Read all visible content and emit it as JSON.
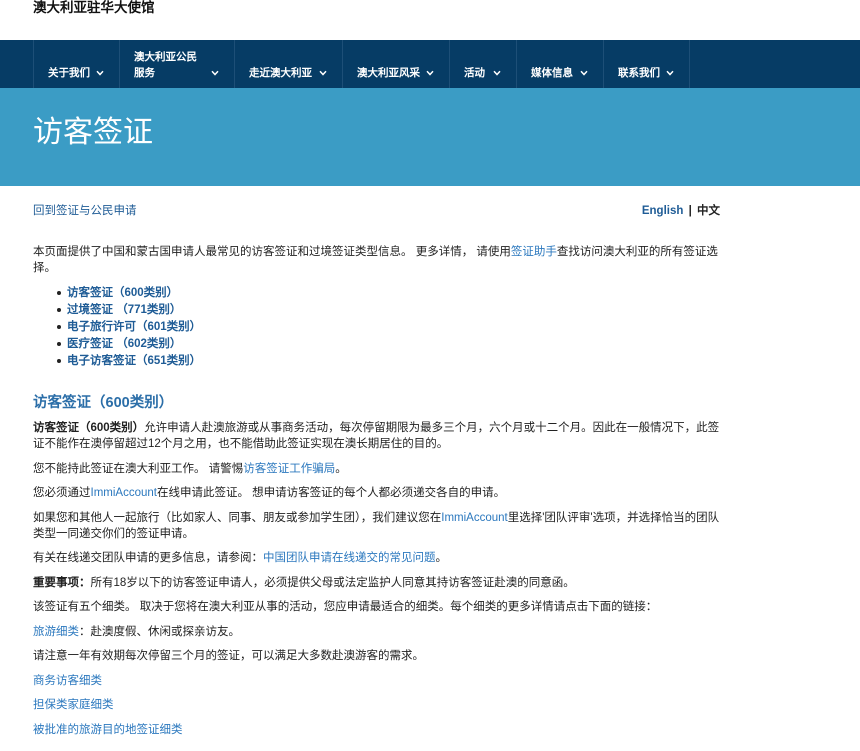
{
  "colors": {
    "nav_bg": "#063c65",
    "banner_bg": "#3b9cc5",
    "link": "#2b78be",
    "link_strong": "#1f5c96",
    "heading": "#2b6ea8",
    "text": "#222222"
  },
  "site": {
    "title": "澳大利亚驻华大使馆"
  },
  "nav": {
    "chevron_icon": "chevron-down-icon",
    "items": [
      {
        "label": "关于我们"
      },
      {
        "label": "澳大利亚公民",
        "label_line2": "服务"
      },
      {
        "label": "走近澳大利亚"
      },
      {
        "label": "澳大利亚风采"
      },
      {
        "label": "活动"
      },
      {
        "label": "媒体信息"
      },
      {
        "label": "联系我们"
      }
    ]
  },
  "banner": {
    "title": "访客签证"
  },
  "breadcrumb": {
    "back_link": "回到签证与公民申请"
  },
  "language": {
    "english": "English",
    "separator": "|",
    "chinese": "中文"
  },
  "intro": {
    "text_before": "本页面提供了中国和蒙古国申请人最常见的访客签证和过境签证类型信息。 更多详情， 请使用",
    "link": "签证助手",
    "text_after": "查找访问澳大利亚的所有签证选择。"
  },
  "toc": {
    "items": [
      "访客签证（600类别）",
      "过境签证 （771类别）",
      "电子旅行许可（601类别）",
      "医疗签证 （602类别）",
      "电子访客签证（651类别）"
    ]
  },
  "section_600": {
    "heading": "访客签证（600类别）",
    "p1": {
      "bold": "访客签证（600类别）",
      "text": "允许申请人赴澳旅游或从事商务活动，每次停留期限为最多三个月，六个月或十二个月。因此在一般情况下，此签证不能作在澳停留超过12个月之用，也不能借助此签证实现在澳长期居住的目的。"
    },
    "p2": {
      "text_before": "您不能持此签证在澳大利亚工作。 请警惕",
      "link": "访客签证工作骗局",
      "text_after": "。"
    },
    "p3": {
      "text_before": "您必须通过",
      "link": "ImmiAccount",
      "text_after": "在线申请此签证。 想申请访客签证的每个人都必须递交各自的申请。"
    },
    "p4": {
      "text_before": "如果您和其他人一起旅行（比如家人、同事、朋友或参加学生团），我们建议您在",
      "link": "ImmiAccount",
      "text_after": "里选择'团队评审'选项，并选择恰当的团队类型一同递交你们的签证申请。"
    },
    "p5": {
      "text_before": "有关在线递交团队申请的更多信息，请参阅：",
      "link": "中国团队申请在线递交的常见问题",
      "text_after": "。"
    },
    "p6": {
      "bold": "重要事项：",
      "text": "所有18岁以下的访客签证申请人，必须提供父母或法定监护人同意其持访客签证赴澳的同意函。"
    },
    "p7": {
      "text": "该签证有五个细类。 取决于您将在澳大利亚从事的活动，您应申请最适合的细类。每个细类的更多详情请点击下面的链接："
    },
    "p8": {
      "link": "旅游细类",
      "text_after": "：赴澳度假、休闲或探亲访友。"
    },
    "p9": {
      "text": "请注意一年有效期每次停留三个月的签证，可以满足大多数赴澳游客的需求。"
    },
    "stream_links": [
      "商务访客细类",
      "担保类家庭细类",
      "被批准的旅游目的地签证细类"
    ]
  }
}
